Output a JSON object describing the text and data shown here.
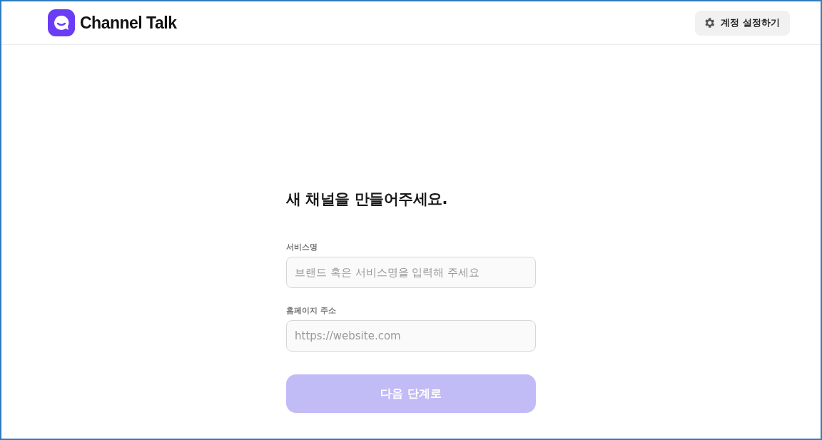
{
  "header": {
    "brand": "Channel Talk",
    "settings_button": "계정 설정하기"
  },
  "form": {
    "title": "새 채널을 만들어주세요.",
    "fields": [
      {
        "label": "서비스명",
        "placeholder": "브랜드 혹은 서비스명을 입력해 주세요"
      },
      {
        "label": "홈페이지 주소",
        "placeholder": "https://website.com"
      }
    ],
    "submit": {
      "label": "다음 단계로",
      "disabled": true
    }
  }
}
